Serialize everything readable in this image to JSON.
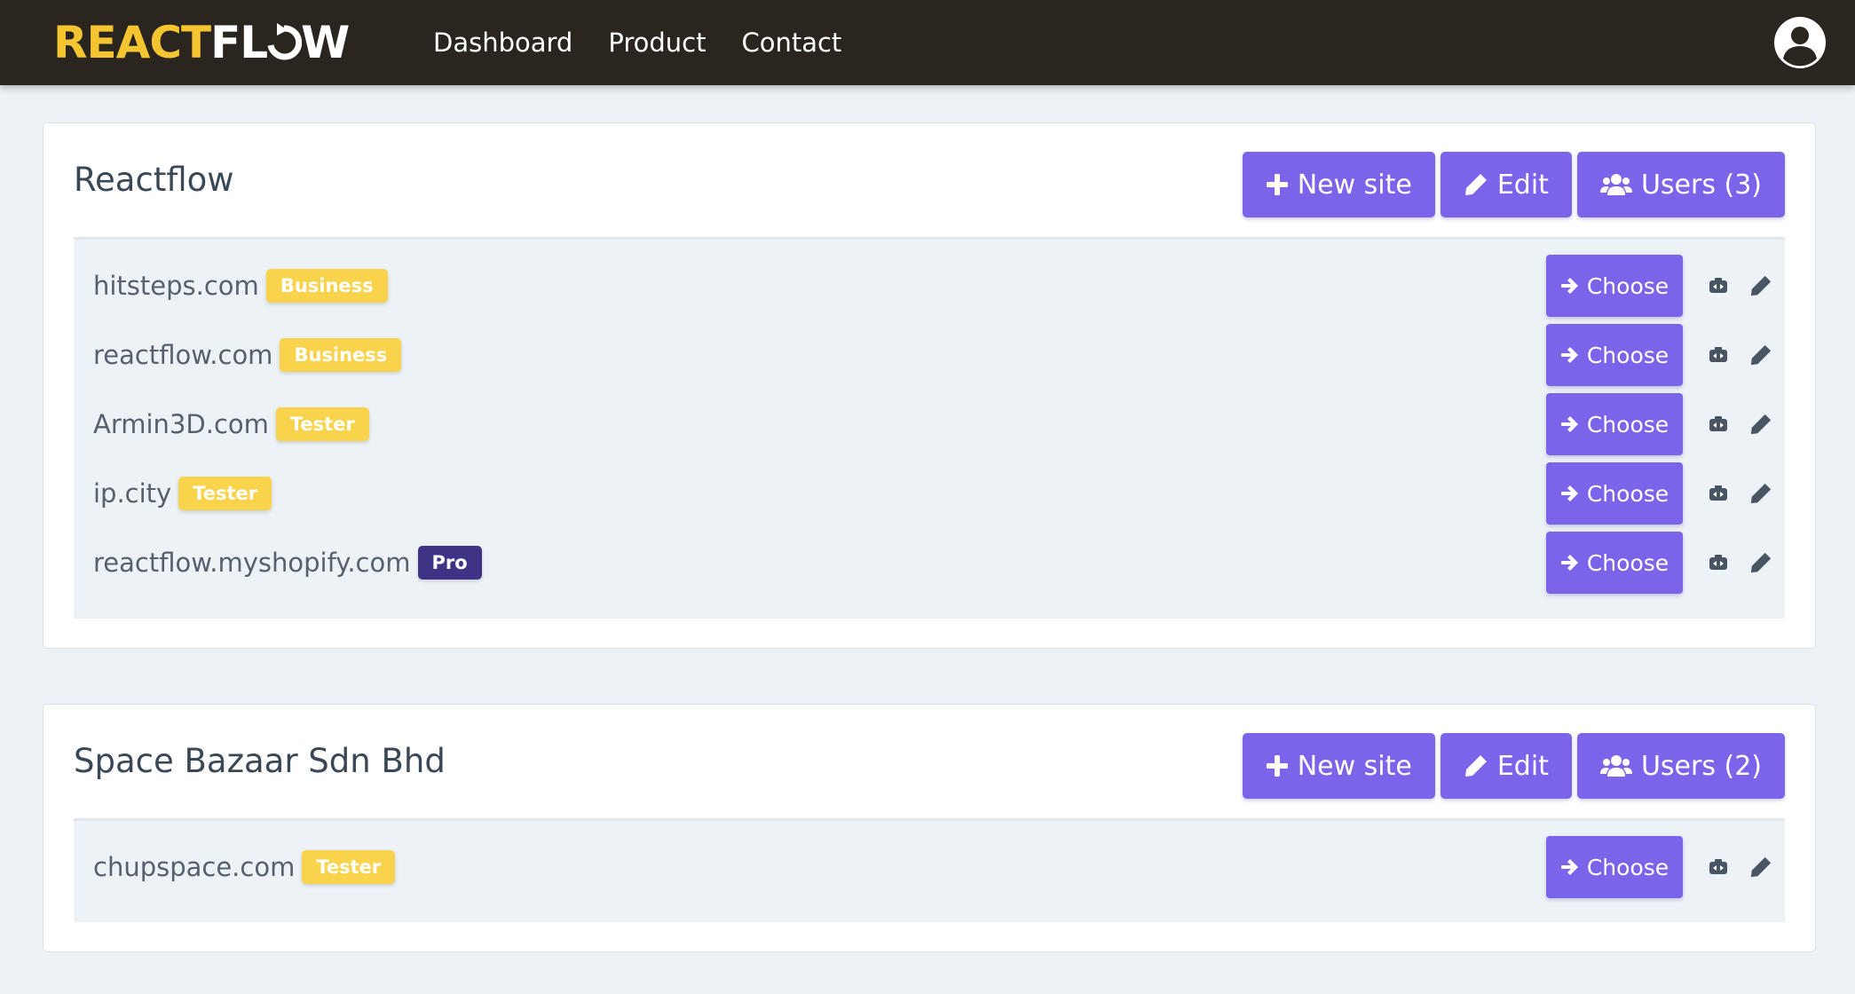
{
  "brand": {
    "part1": "REACT",
    "part2": "FL",
    "part3": "W",
    "colors": {
      "react": "#f5c531",
      "flow": "#ffffff"
    }
  },
  "nav": [
    "Dashboard",
    "Product",
    "Contact"
  ],
  "user_icon": "user-circle-icon",
  "organizations": [
    {
      "name": "Reactflow",
      "buttons": {
        "new_site": "New site",
        "edit": "Edit",
        "users": "Users (3)"
      },
      "sites": [
        {
          "domain": "hitsteps.com",
          "plan": "Business",
          "plan_color": "yellow"
        },
        {
          "domain": "reactflow.com",
          "plan": "Business",
          "plan_color": "yellow"
        },
        {
          "domain": "Armin3D.com",
          "plan": "Tester",
          "plan_color": "yellow"
        },
        {
          "domain": "ip.city",
          "plan": "Tester",
          "plan_color": "yellow"
        },
        {
          "domain": "reactflow.myshopify.com",
          "plan": "Pro",
          "plan_color": "purple"
        }
      ]
    },
    {
      "name": "Space Bazaar Sdn Bhd",
      "buttons": {
        "new_site": "New site",
        "edit": "Edit",
        "users": "Users (2)"
      },
      "sites": [
        {
          "domain": "chupspace.com",
          "plan": "Tester",
          "plan_color": "yellow"
        }
      ]
    }
  ],
  "choose_label": "Choose",
  "row_icons": [
    "switch-icon",
    "pencil-icon"
  ],
  "accent_color": "#7c64ea"
}
